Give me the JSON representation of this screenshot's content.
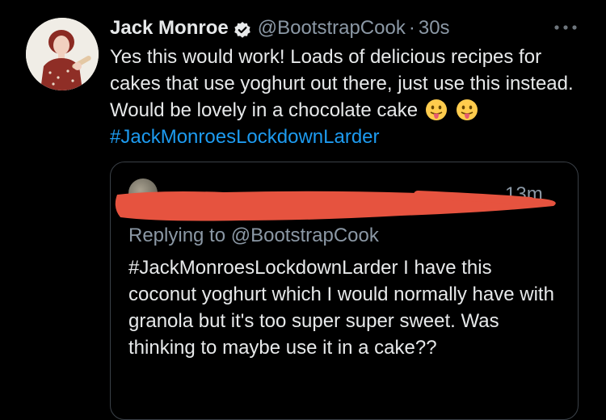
{
  "tweet": {
    "display_name": "Jack Monroe",
    "handle": "@BootstrapCook",
    "separator": "·",
    "time": "30s",
    "text_part1": "Yes this would work! Loads of delicious recipes for cakes that use yoghurt out there, just use this instead. Would be lovely in a chocolate cake",
    "emojis": [
      "tongue-out-face",
      "tongue-out-face"
    ],
    "hashtag": "#JackMonroesLockdownLarder",
    "verified": true
  },
  "quoted_tweet": {
    "time_fragment": "13m",
    "replying_to": "Replying to @BootstrapCook",
    "text": "#JackMonroesLockdownLarder I have this coconut yoghurt which I would normally have with granola but it's too super super sweet. Was thinking to maybe use it in a cake??",
    "author_redacted": true
  },
  "colors": {
    "background": "#000000",
    "text": "#e7e9ea",
    "muted": "#8b98a5",
    "link": "#1d9bf0",
    "redaction": "#e6533f",
    "border": "#3a4047"
  },
  "icons": [
    "verified-badge-icon",
    "more-options-icon",
    "tongue-out-emoji-icon"
  ]
}
